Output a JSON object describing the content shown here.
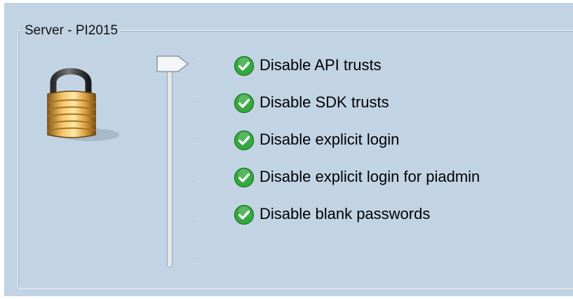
{
  "group": {
    "title": "Server - PI2015"
  },
  "icons": {
    "security": "padlock-icon",
    "item_status": "green-check-icon",
    "slider_thumb": "slider-thumb-arrow"
  },
  "slider": {
    "level": "Disable API trusts",
    "tick_count": 6
  },
  "items": [
    {
      "label": "Disable API trusts",
      "status": "enabled"
    },
    {
      "label": "Disable SDK trusts",
      "status": "enabled"
    },
    {
      "label": "Disable explicit login",
      "status": "enabled"
    },
    {
      "label": "Disable explicit login for piadmin",
      "status": "enabled"
    },
    {
      "label": "Disable blank passwords",
      "status": "enabled"
    }
  ],
  "colors": {
    "panel_background": "#c2d4e4",
    "check_green": "#35a83f",
    "text": "#000000"
  }
}
